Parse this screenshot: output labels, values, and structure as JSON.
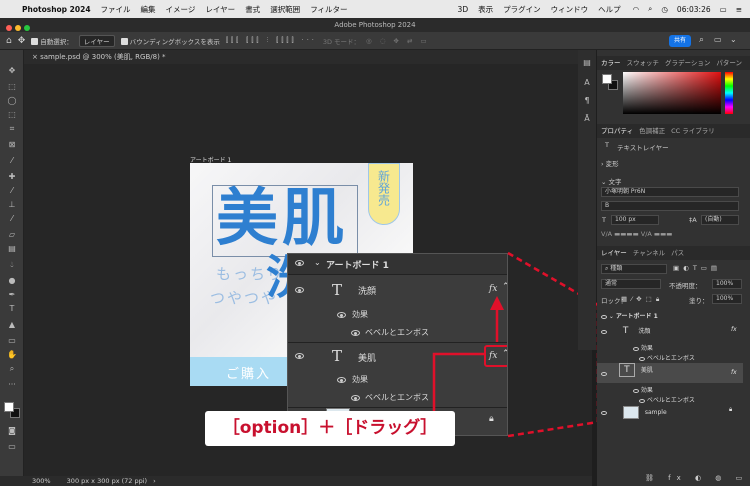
{
  "menubar": {
    "app": "Photoshop 2024",
    "items": [
      "ファイル",
      "編集",
      "イメージ",
      "レイヤー",
      "書式",
      "選択範囲",
      "フィルター",
      "3D",
      "表示",
      "プラグイン",
      "ウィンドウ",
      "ヘルプ"
    ],
    "time": "06:03:26"
  },
  "window": {
    "title": "Adobe Photoshop 2024"
  },
  "options_bar": {
    "auto_select": "自動選択：",
    "auto_select_value": "レイヤー",
    "bounding_box": "バウンディングボックスを表示",
    "mode_3d": "3D モード：",
    "share": "共有"
  },
  "document": {
    "tab": "sample.psd @ 300% (美肌, RGB/8) *",
    "zoom": "300%",
    "dimensions": "300 px x 300 px (72 ppi)"
  },
  "artboard": {
    "label": "アートボード 1",
    "badge": "新発売",
    "headline1": "美肌",
    "headline2": "洗",
    "sub1": "もっちり",
    "sub2": "つやつや",
    "cta": "ご購入"
  },
  "zoom_layers": {
    "group": "アートボード 1",
    "layer1": "洗顔",
    "effects1": "効果",
    "bevel1": "ベベルとエンボス",
    "layer2": "美肌",
    "effects2": "効果",
    "bevel2": "ベベルとエンボス",
    "fx": "fx"
  },
  "callout": "［option］＋［ドラッグ］",
  "panels": {
    "color_tabs": [
      "カラー",
      "スウォッチ",
      "グラデーション",
      "パターン"
    ],
    "properties_tabs": [
      "プロパティ",
      "色調補正",
      "CC ライブラリ"
    ],
    "text_layer": "テキストレイヤー",
    "transform": "変形",
    "character": "文字",
    "font_name": "小塚明朝 Pr6N",
    "font_style": "B",
    "font_size": "100 px",
    "leading": "(自動)",
    "layers_tabs": [
      "レイヤー",
      "チャンネル",
      "パス"
    ],
    "kind": "種類",
    "blend_mode": "通常",
    "opacity_label": "不透明度：",
    "opacity": "100%",
    "lock": "ロック：",
    "fill_label": "塗り：",
    "fill": "100%",
    "layers": [
      {
        "name": "アートボード 1",
        "indent": 0
      },
      {
        "name": "洗顔",
        "indent": 1
      },
      {
        "name": "効果",
        "indent": 2
      },
      {
        "name": "ベベルとエンボス",
        "indent": 3
      },
      {
        "name": "美肌",
        "indent": 1
      },
      {
        "name": "効果",
        "indent": 2
      },
      {
        "name": "ベベルとエンボス",
        "indent": 3
      },
      {
        "name": "sample",
        "indent": 1
      }
    ]
  },
  "colors": {
    "accent_red": "#e0102a",
    "photoshop_blue": "#1473e6",
    "headline_blue": "#2e7fd0"
  }
}
